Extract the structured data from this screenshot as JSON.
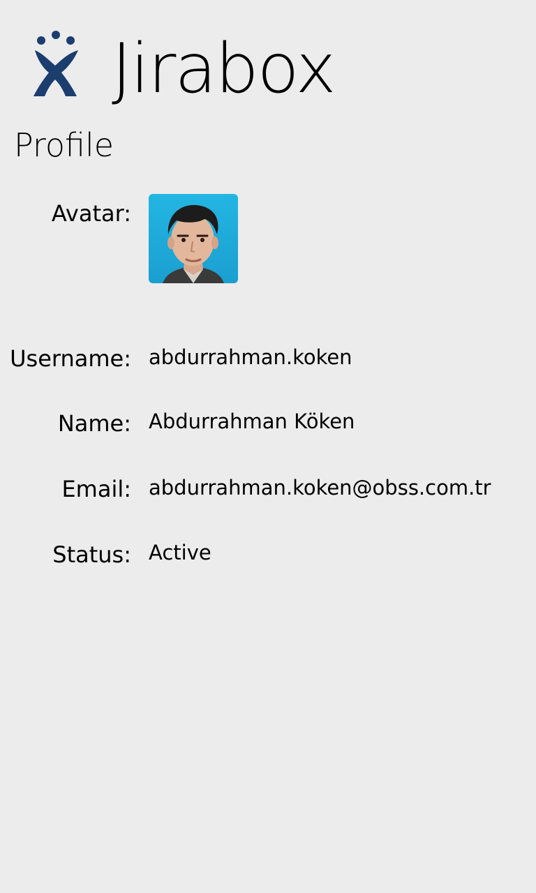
{
  "app": {
    "title": "Jirabox",
    "logo_icon": "jira-logo-icon",
    "brand_color": "#1b3e6f"
  },
  "page": {
    "title": "Profile"
  },
  "profile": {
    "avatar_label": "Avatar:",
    "avatar_icon": "user-avatar-photo",
    "username_label": "Username:",
    "username": "abdurrahman.koken",
    "name_label": "Name:",
    "name": "Abdurrahman Köken",
    "email_label": "Email:",
    "email": "abdurrahman.koken@obss.com.tr",
    "status_label": "Status:",
    "status": "Active"
  }
}
